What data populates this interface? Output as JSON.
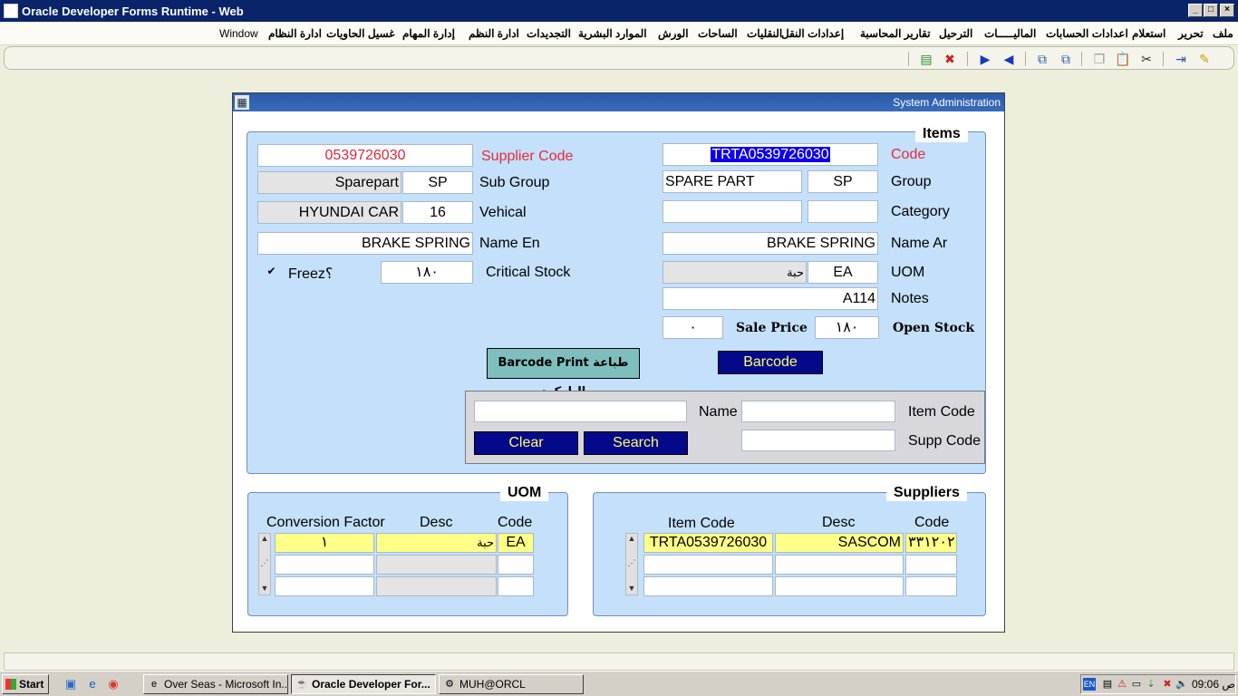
{
  "window": {
    "title": "Oracle Developer Forms Runtime - Web"
  },
  "menu": [
    "ملف",
    "تحرير",
    "استعلام",
    "اعدادات الحسابات",
    "الماليـــــات",
    "الترحيل",
    "تقارير المحاسبة",
    "إعدادات النقل",
    "النقليات",
    "الساحات",
    "الورش",
    "الموارد البشرية",
    "التجديدات",
    "ادارة النظم",
    "إدارة المهام",
    "غسيل الحاويات",
    "ادارة النظام",
    "Window"
  ],
  "toolbar_icons": [
    "insert-record-icon",
    "delete-record-icon",
    "next-record-icon",
    "previous-record-icon",
    "query-help-icon",
    "query-list-icon",
    "copy-icon",
    "paste-icon",
    "cut-icon",
    "exit-icon",
    "edit-icon"
  ],
  "form": {
    "window_title": "System Administration",
    "items_frame": {
      "title": "Items",
      "supplier_code": {
        "label": "Supplier Code",
        "value": "0539726030"
      },
      "code": {
        "label": "Code",
        "value": "TRTA0539726030"
      },
      "sub_group": {
        "label": "Sub Group",
        "name": "Sparepart",
        "code": "SP"
      },
      "group": {
        "label": "Group",
        "name": "SPARE PART",
        "code": "SP"
      },
      "vehical": {
        "label": "Vehical",
        "name": "HYUNDAI CAR",
        "code": "16"
      },
      "category": {
        "label": "Category",
        "name": "",
        "code": ""
      },
      "name_en": {
        "label": "Name En",
        "value": "BRAKE SPRING"
      },
      "name_ar": {
        "label": "Name Ar",
        "value": "BRAKE SPRING"
      },
      "freez": {
        "label": "Freez؟",
        "checked": true
      },
      "critical_stock": {
        "label": "Critical Stock",
        "value": "١٨٠"
      },
      "uom": {
        "label": "UOM",
        "name": "حبة",
        "code": "EA"
      },
      "notes": {
        "label": "Notes",
        "value": "A114"
      },
      "sale_price": {
        "label": "Sale Price",
        "value": "٠"
      },
      "open_stock": {
        "label": "Open Stock",
        "value": "١٨٠"
      },
      "barcode_print_button": "Barcode Print طباعة الباركود",
      "barcode_button": "Barcode"
    },
    "search_panel": {
      "name_label": "Name",
      "name_value": "",
      "item_code_label": "Item Code",
      "item_code_value": "",
      "supp_code_label": "Supp Code",
      "supp_code_value": "",
      "clear_button": "Clear",
      "search_button": "Search"
    },
    "uom_frame": {
      "title": "UOM",
      "columns": [
        "Conversion Factor",
        "Desc",
        "Code"
      ],
      "rows": [
        {
          "factor": "١",
          "desc": "حبة",
          "code": "EA"
        },
        {
          "factor": "",
          "desc": "",
          "code": ""
        },
        {
          "factor": "",
          "desc": "",
          "code": ""
        }
      ]
    },
    "suppliers_frame": {
      "title": "Suppliers",
      "columns": [
        "Item Code",
        "Desc",
        "Code"
      ],
      "rows": [
        {
          "item_code": "TRTA0539726030",
          "desc": "SASCOM",
          "code": "٣٣١٢٠٢"
        },
        {
          "item_code": "",
          "desc": "",
          "code": ""
        },
        {
          "item_code": "",
          "desc": "",
          "code": ""
        }
      ]
    }
  },
  "taskbar": {
    "start": "Start",
    "tasks": [
      {
        "label": "Over Seas - Microsoft In...",
        "active": false
      },
      {
        "label": "Oracle Developer For...",
        "active": true
      },
      {
        "label": "MUH@ORCL",
        "active": false
      }
    ],
    "lang": "EN",
    "clock": "09:06 ص"
  }
}
